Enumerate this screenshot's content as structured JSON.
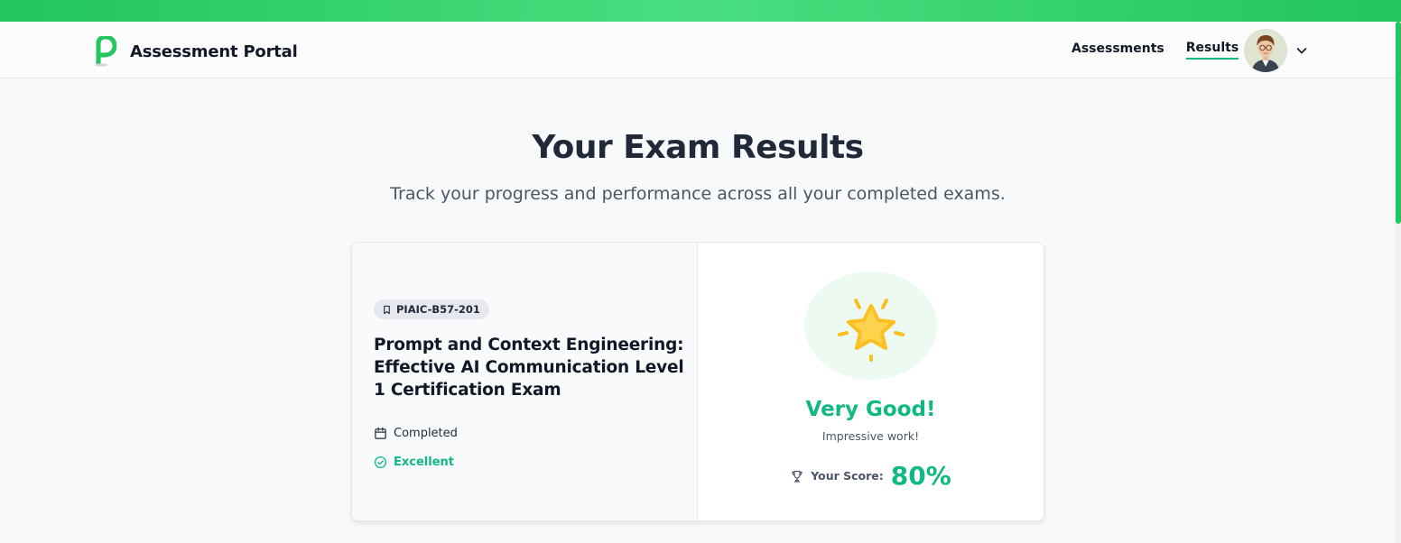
{
  "app": {
    "title": "Assessment Portal",
    "accent_color": "#10b981",
    "logo_icon": "p-pin-logo"
  },
  "nav": {
    "items": [
      {
        "label": "Assessments",
        "active": false
      },
      {
        "label": "Results",
        "active": true
      }
    ],
    "user_menu_icon": "chevron-down-icon"
  },
  "header": {
    "title": "Your Exam Results",
    "subtitle": "Track your progress and performance across all your completed exams."
  },
  "results": [
    {
      "code": "PIAIC-B57-201",
      "code_icon": "bookmark-icon",
      "title": "Prompt and Context Engineering: Effective AI Communication Level 1 Certification Exam",
      "status": "Completed",
      "status_icon": "calendar-icon",
      "grade": "Excellent",
      "grade_icon": "check-circle-icon",
      "rating_icon": "star-icon",
      "rating": "Very Good!",
      "rating_note": "Impressive work!",
      "score_label": "Your Score:",
      "score_icon": "trophy-icon",
      "score": "80%"
    }
  ]
}
